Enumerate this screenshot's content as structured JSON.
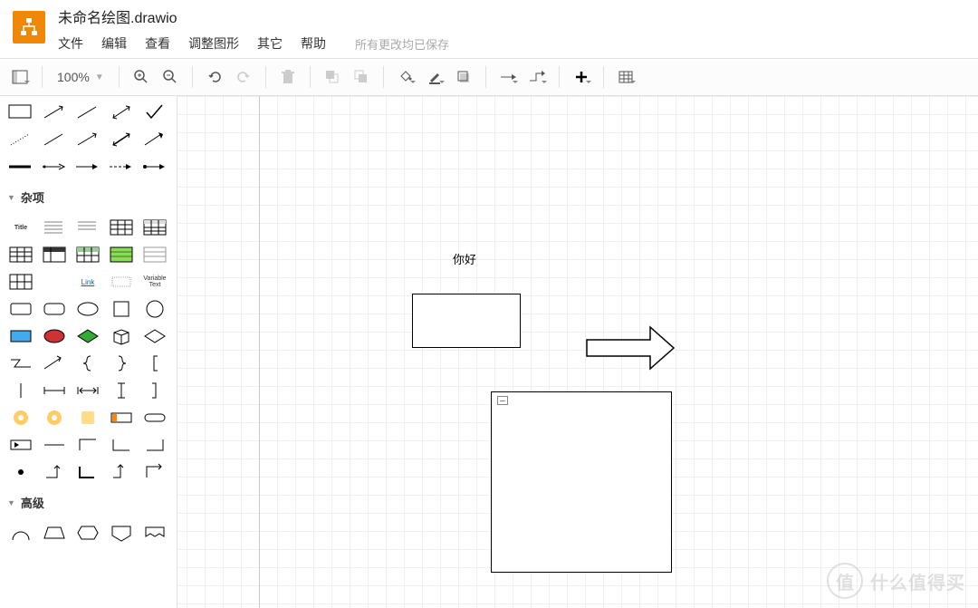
{
  "header": {
    "title": "未命名绘图.drawio",
    "menu": {
      "file": "文件",
      "edit": "编辑",
      "view": "查看",
      "adjust": "调整图形",
      "other": "其它",
      "help": "帮助"
    },
    "save_status": "所有更改均已保存"
  },
  "toolbar": {
    "zoom": "100%"
  },
  "sidebar": {
    "section_misc": "杂项",
    "section_advanced": "高级",
    "link_label": "Link",
    "title_label": "Title",
    "vartext_label": "Variable Text"
  },
  "canvas": {
    "text1": "你好"
  },
  "watermark": {
    "badge": "值",
    "text": "什么值得买"
  }
}
